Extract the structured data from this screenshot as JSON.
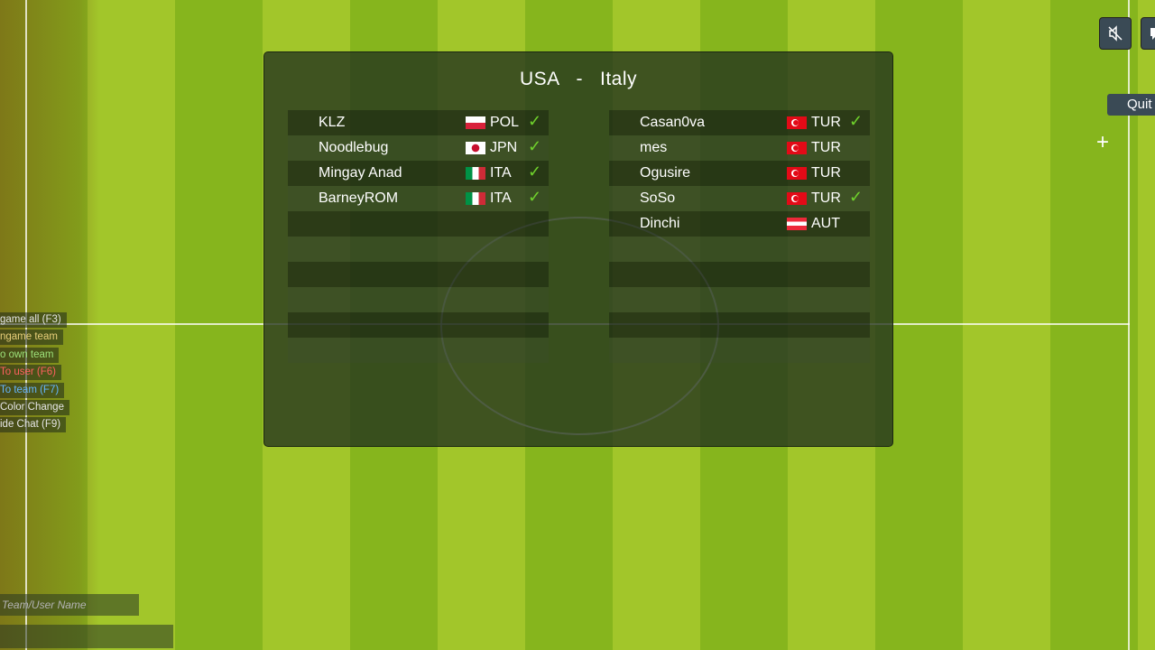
{
  "match": {
    "home_team": "USA",
    "separator": "-",
    "away_team": "Italy"
  },
  "home_players": [
    {
      "name": "KLZ",
      "country": "POL",
      "ready": true
    },
    {
      "name": "Noodlebug",
      "country": "JPN",
      "ready": true
    },
    {
      "name": "Mingay Anad",
      "country": "ITA",
      "ready": true
    },
    {
      "name": "BarneyROM",
      "country": "ITA",
      "ready": true
    }
  ],
  "away_players": [
    {
      "name": "Casan0va",
      "country": "TUR",
      "ready": true
    },
    {
      "name": "mes",
      "country": "TUR",
      "ready": false
    },
    {
      "name": "Ogusire",
      "country": "TUR",
      "ready": false
    },
    {
      "name": "SoSo",
      "country": "TUR",
      "ready": true
    },
    {
      "name": "Dinchi",
      "country": "AUT",
      "ready": false
    }
  ],
  "check_glyph": "✓",
  "top_right": {
    "mute_icon": "speaker-muted-icon",
    "chat_icon": "speech-bubble-icon",
    "quit_label": "Quit",
    "crosshair": "+"
  },
  "chat_options": [
    {
      "label": "game all (F3)",
      "color": "#e6e6e6"
    },
    {
      "label": "ngame team",
      "color": "#e8cf7a"
    },
    {
      "label": "o own team",
      "color": "#9de27a"
    },
    {
      "label": "To user (F6)",
      "color": "#ff6060"
    },
    {
      "label": "To team (F7)",
      "color": "#66b6ff"
    },
    {
      "label": "Color Change",
      "color": "#e6e6e6"
    },
    {
      "label": "ide Chat (F9)",
      "color": "#e6e6e6"
    }
  ],
  "search": {
    "placeholder": "Team/User Name"
  },
  "colors": {
    "pitch_light": "#a2c62a",
    "pitch_dark": "#86b51d",
    "check": "#6fd12c"
  }
}
